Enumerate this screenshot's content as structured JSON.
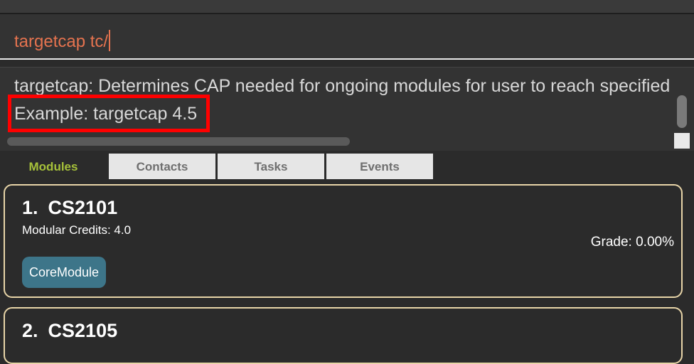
{
  "command": {
    "input_value": "targetcap tc/"
  },
  "result": {
    "line1": "targetcap: Determines CAP needed for ongoing modules for user to reach specified target CAP.",
    "line2": "Example: targetcap 4.5"
  },
  "tabs": [
    {
      "label": "Modules",
      "active": true
    },
    {
      "label": "Contacts",
      "active": false
    },
    {
      "label": "Tasks",
      "active": false
    },
    {
      "label": "Events",
      "active": false
    }
  ],
  "modules": [
    {
      "index": "1.",
      "code": "CS2101",
      "credits": "Modular Credits: 4.0",
      "grade": "Grade: 0.00%",
      "tag": "CoreModule"
    },
    {
      "index": "2.",
      "code": "CS2105"
    }
  ],
  "colors": {
    "command_text": "#e5734f",
    "active_tab": "#a6c13a",
    "tag_bg": "#3d7589",
    "highlight": "#ff0000",
    "card_border": "#e8d5a8"
  }
}
